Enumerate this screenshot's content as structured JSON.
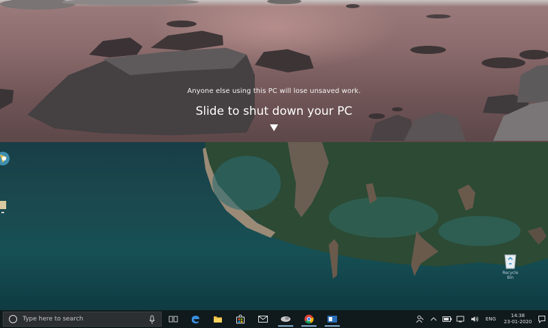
{
  "slide_to_shutdown": {
    "warning": "Anyone else using this PC will lose unsaved work.",
    "title": "Slide to shut down your PC"
  },
  "desktop": {
    "recycle_bin_label": "Recycle Bin"
  },
  "taskbar": {
    "search_placeholder": "Type here to search",
    "apps": [
      "task-view",
      "edge",
      "file-explorer",
      "store",
      "mail",
      "app",
      "chrome",
      "app-blue"
    ],
    "tray": {
      "language": "ENG",
      "time": "14:38",
      "date": "23-01-2020"
    }
  },
  "colors": {
    "taskbar_bg": "#101a1d",
    "slide_bg": "#8a6a6b",
    "desktop_bg": "#1a4a4f"
  }
}
